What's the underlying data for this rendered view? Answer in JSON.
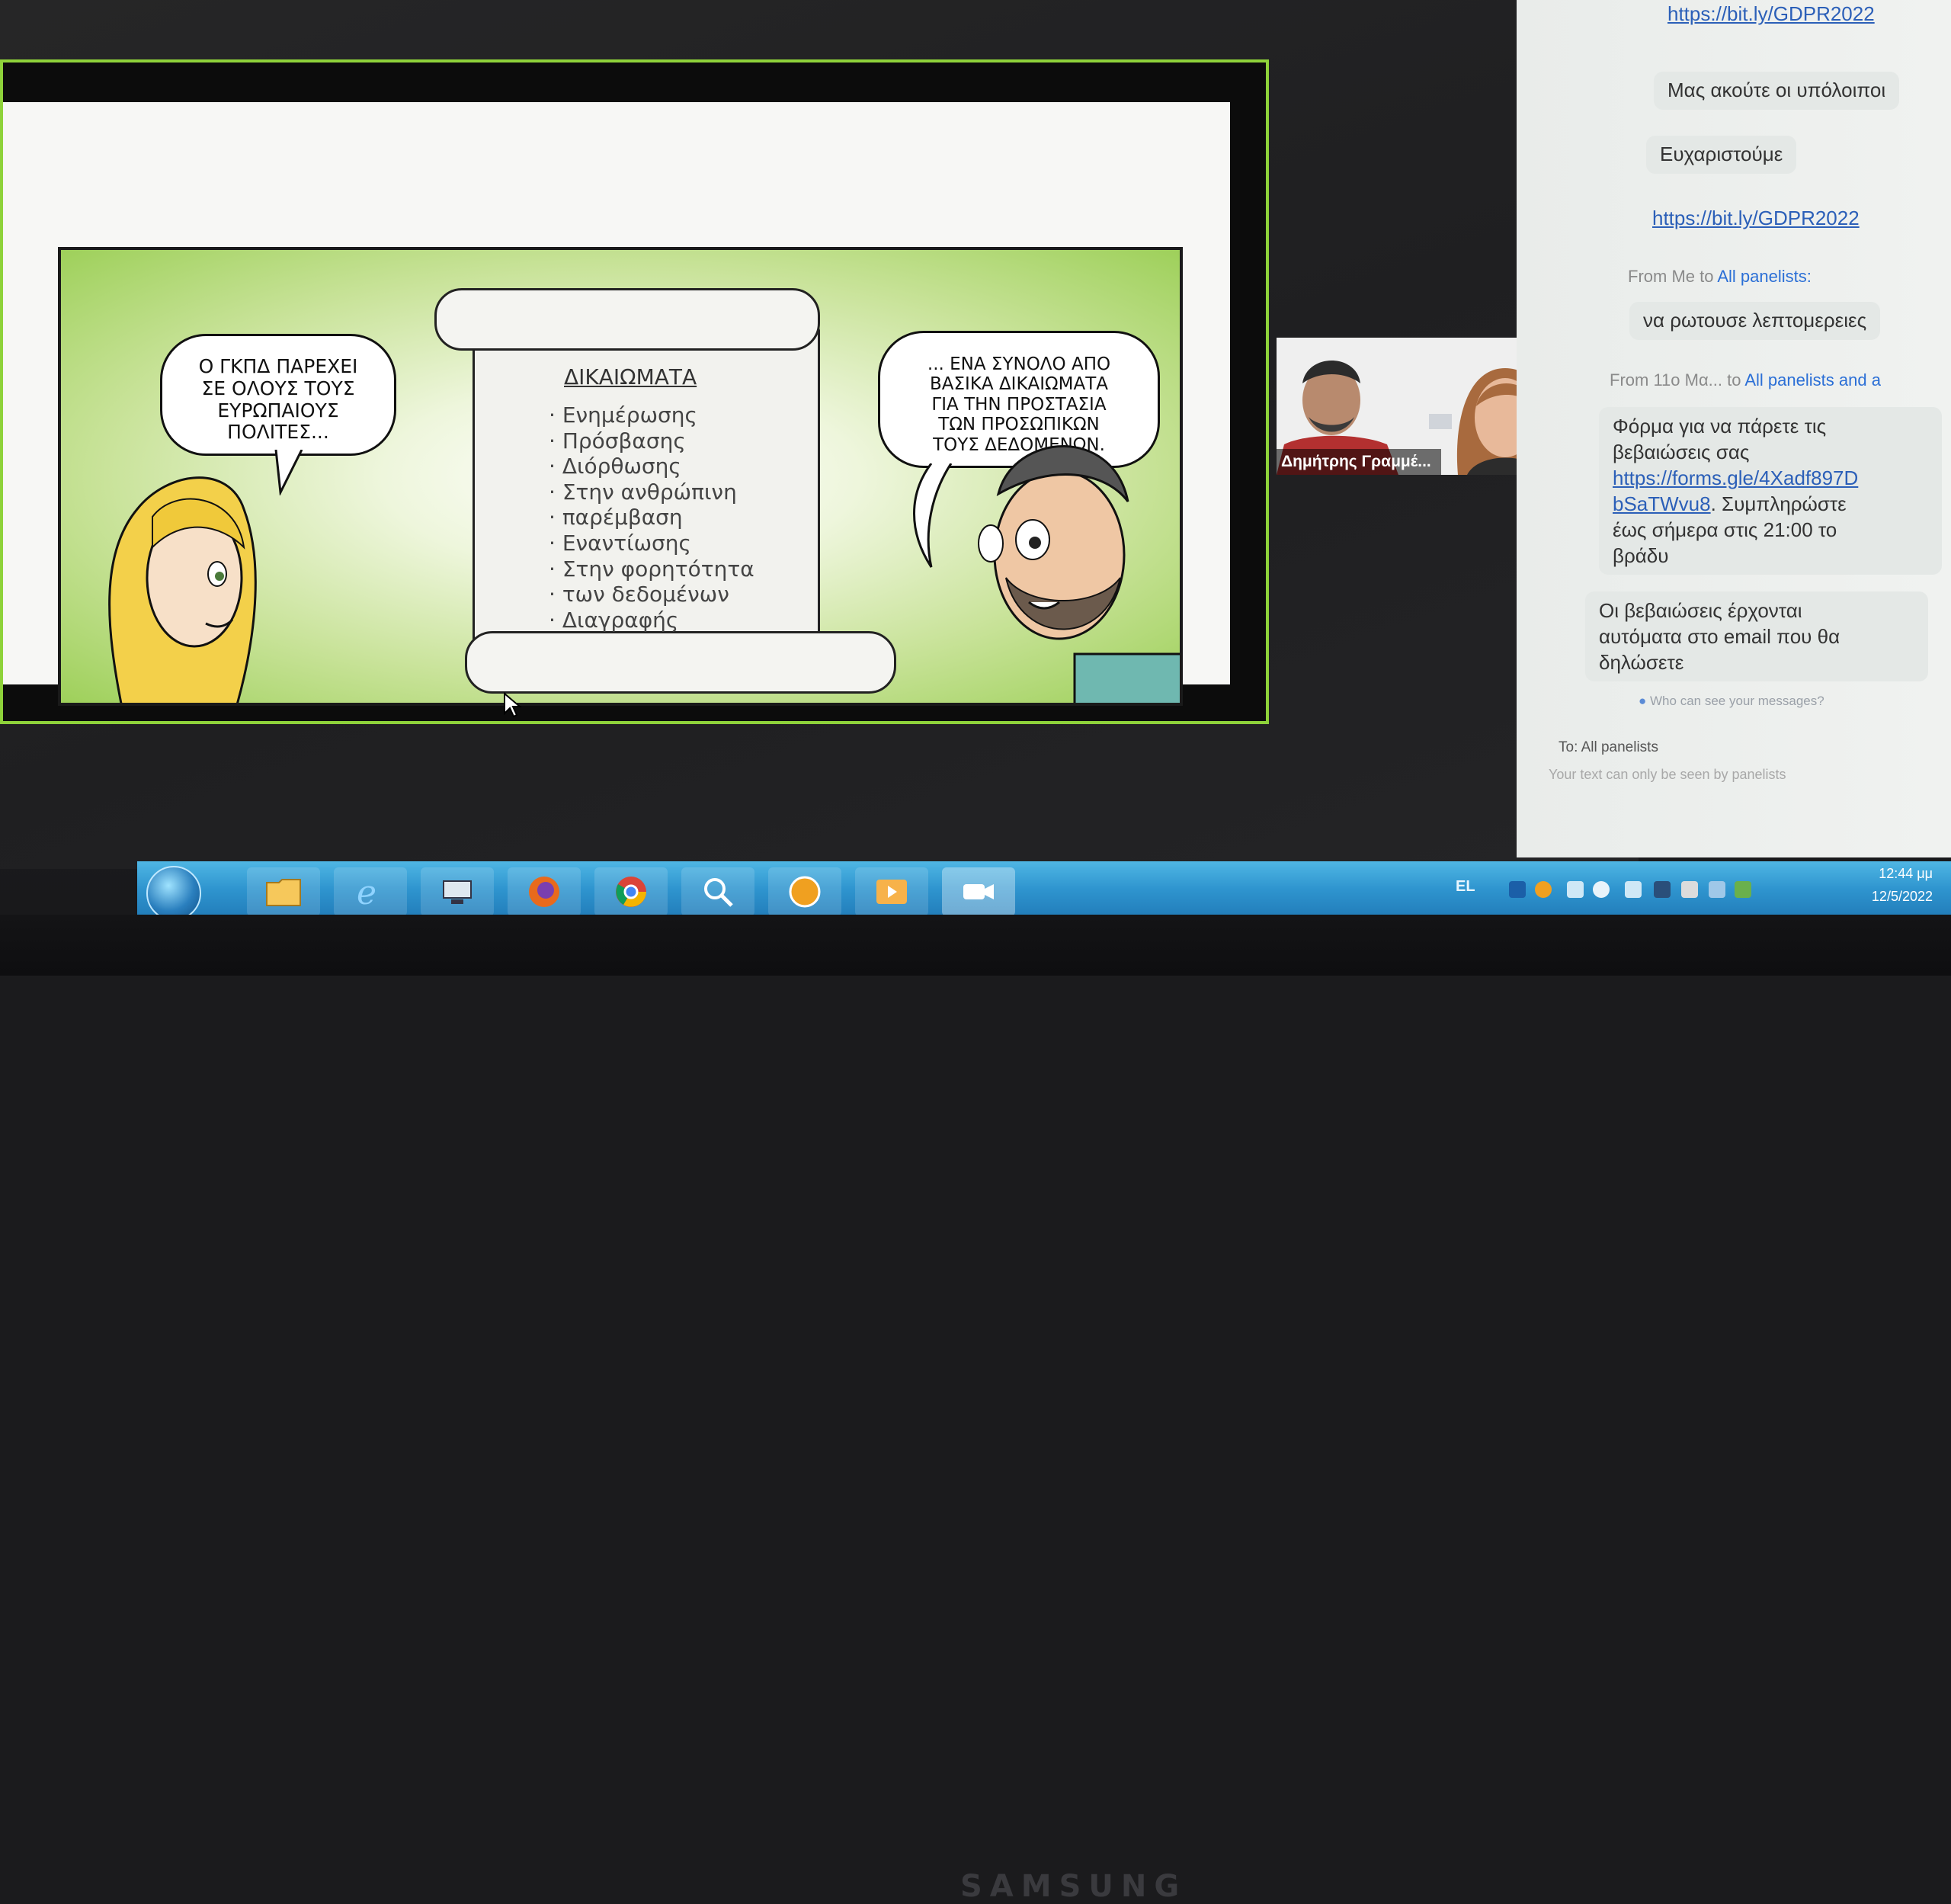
{
  "slide": {
    "bubble_left": [
      "Ο ΓΚΠΔ ΠΑΡΕΧΕΙ",
      "ΣΕ ΟΛΟΥΣ ΤΟΥΣ",
      "ΕΥΡΩΠΑΙΟΥΣ",
      "ΠΟΛΙΤΕΣ..."
    ],
    "bubble_right": [
      "... ΕΝΑ ΣΥΝΟΛΟ ΑΠΟ",
      "ΒΑΣΙΚΑ ΔΙΚΑΙΩΜΑΤΑ",
      "ΓΙΑ ΤΗΝ ΠΡΟΣΤΑΣΙΑ",
      "ΤΩΝ ΠΡΟΣΩΠΙΚΩΝ",
      "ΤΟΥΣ ΔΕΔΟΜΕΝΩΝ."
    ],
    "scroll_title": "ΔΙΚΑΙΩΜΑΤΑ",
    "rights": [
      "Ενημέρωσης",
      "Πρόσβασης",
      "Διόρθωσης",
      "Στην ανθρώπινη",
      "παρέμβαση",
      "Εναντίωσης",
      "Στην φορητότητα",
      "των δεδομένων",
      "Διαγραφής"
    ]
  },
  "video": {
    "participant_name": "Δημήτρης Γραμμέ..."
  },
  "chat": {
    "messages": [
      {
        "text": "https://bit.ly/GDPR2022",
        "link": true
      },
      {
        "text": "Μας ακούτε οι υπόλοιποι"
      },
      {
        "text": "Ευχαριστούμε"
      },
      {
        "text": "https://bit.ly/GDPR2022",
        "link": true
      }
    ],
    "meta1": {
      "prefix": "From Me to ",
      "target": "All panelists:"
    },
    "msg5": "να ρωτουσε λεπτομερειες",
    "meta2": {
      "prefix": "From 11ο Μα...  to ",
      "target": "All panelists and a"
    },
    "msg6": {
      "line1": "Φόρμα για να πάρετε τις",
      "line2": "βεβαιώσεις σας",
      "link1": "https://forms.gle/4Xadf897D",
      "link2": "bSaTWvu8",
      "rest1": ". Συμπληρώστε",
      "line4": "έως σήμερα στις 21:00 το",
      "line5": "βράδυ"
    },
    "msg7": [
      "Οι βεβαιώσεις έρχονται",
      "αυτόματα στο email που θα",
      "δηλώσετε"
    ],
    "who_can_see": "Who can see your messages?",
    "to_label": "To:  All panelists",
    "compose_placeholder": "Your text can only be seen by panelists"
  },
  "taskbar": {
    "apps": [
      "folder-icon",
      "internet-explorer-icon",
      "network-icon",
      "firefox-icon",
      "chrome-icon",
      "search-app-icon",
      "app-orange-icon",
      "media-player-icon",
      "video-meeting-icon"
    ],
    "language": "EL",
    "time": "12:44 μμ",
    "date": "12/5/2022"
  },
  "monitor_brand": "SAMSUNG",
  "colors": {
    "slide_border": "#8ed23a",
    "taskbar": "#2f95cf",
    "chat_link": "#2b5fb8",
    "meta_blue": "#2b6fd6"
  }
}
